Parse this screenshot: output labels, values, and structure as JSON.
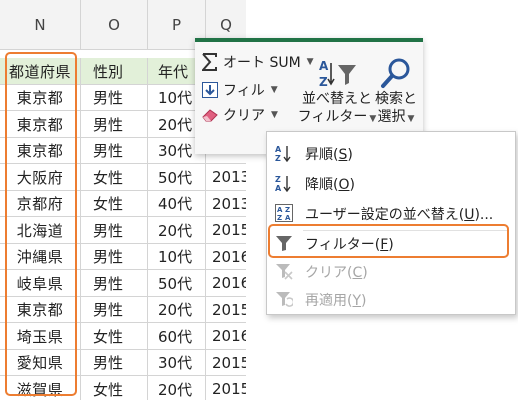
{
  "sheet": {
    "columns": [
      "N",
      "O",
      "P",
      "Q"
    ],
    "header_row": [
      "都道府県",
      "性別",
      "年代",
      ""
    ],
    "rows": [
      [
        "東京都",
        "男性",
        "10代",
        ""
      ],
      [
        "東京都",
        "男性",
        "20代",
        ""
      ],
      [
        "東京都",
        "男性",
        "30代",
        ""
      ],
      [
        "大阪府",
        "女性",
        "50代",
        "2013"
      ],
      [
        "京都府",
        "女性",
        "40代",
        "2013"
      ],
      [
        "北海道",
        "男性",
        "20代",
        "2015"
      ],
      [
        "沖縄県",
        "男性",
        "10代",
        "2016"
      ],
      [
        "岐阜県",
        "男性",
        "50代",
        "2016"
      ],
      [
        "東京都",
        "男性",
        "20代",
        "2015"
      ],
      [
        "埼玉県",
        "女性",
        "60代",
        "2016"
      ],
      [
        "愛知県",
        "男性",
        "30代",
        "2015"
      ],
      [
        "滋賀県",
        "女性",
        "20代",
        "2015"
      ]
    ]
  },
  "ribbon": {
    "autosum_label": "オート SUM",
    "fill_label": "フィル",
    "clear_label": "クリア",
    "sort_filter_line1": "並べ替えと",
    "sort_filter_line2": "フィルター",
    "find_select_line1": "検索と",
    "find_select_line2": "選択"
  },
  "menu": {
    "items": [
      {
        "label": "昇順(",
        "key": "S",
        "icon": "sort-ascending-icon",
        "enabled": true
      },
      {
        "label": "降順(",
        "key": "O",
        "icon": "sort-descending-icon",
        "enabled": true
      },
      {
        "label": "ユーザー設定の並べ替え(",
        "key": "U",
        "suffix": ")...",
        "icon": "custom-sort-icon",
        "enabled": true
      },
      {
        "label": "フィルター(",
        "key": "F",
        "icon": "filter-icon",
        "enabled": true,
        "highlighted": true
      },
      {
        "label": "クリア(",
        "key": "C",
        "icon": "clear-filter-icon",
        "enabled": false
      },
      {
        "label": "再適用(",
        "key": "Y",
        "icon": "reapply-icon",
        "enabled": false
      }
    ]
  },
  "colors": {
    "highlight": "#ed7d31",
    "header_fill": "#e2f0d9",
    "ribbon_accent": "#217346",
    "icon_blue": "#2b579a"
  }
}
